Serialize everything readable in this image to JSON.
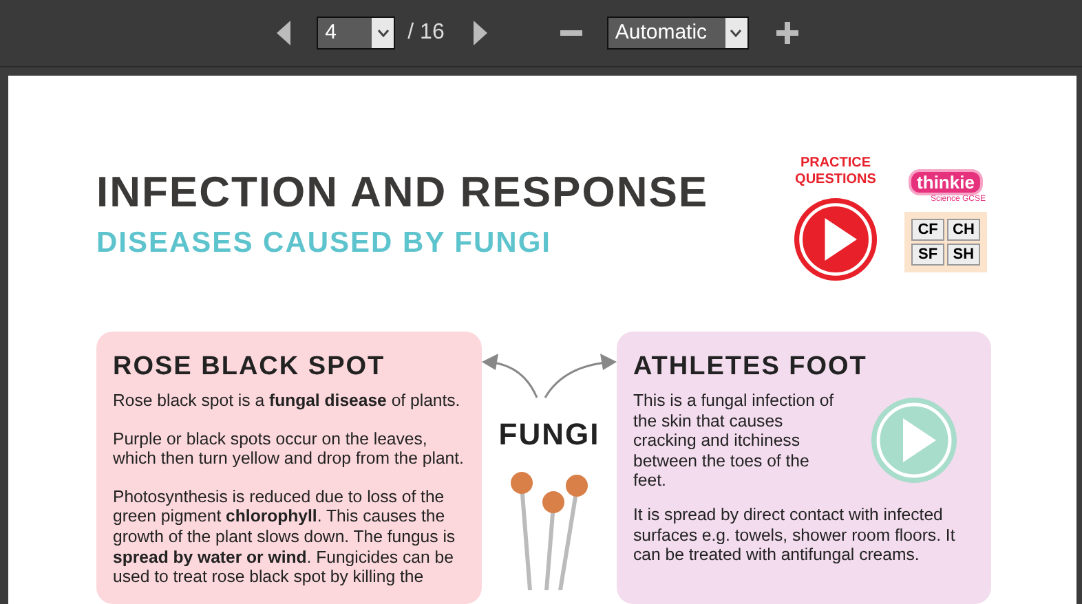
{
  "viewer": {
    "page_number": "4",
    "page_count": "/ 16",
    "zoom": "Automatic"
  },
  "header": {
    "title": "INFECTION AND RESPONSE",
    "subtitle": "DISEASES CAUSED BY FUNGI",
    "practice_label": "PRACTICE QUESTIONS",
    "logo": {
      "name": "thinkie",
      "tagline": "Science GCSE"
    },
    "tier_buttons": [
      "CF",
      "CH",
      "SF",
      "SH"
    ]
  },
  "center_label": "FUNGI",
  "cards": [
    {
      "title": "ROSE BLACK SPOT",
      "color": "#fcd8dc",
      "has_video": false,
      "paragraphs": [
        "Rose black spot is a **fungal disease** of plants.",
        "Purple or black spots occur on the leaves, which then turn yellow and drop from the plant.",
        "Photosynthesis is reduced due to loss of the green pigment **chlorophyll**. This causes the growth of the plant slows down. The fungus is **spread by water or wind**. Fungicides can be used to treat rose black spot by killing the"
      ]
    },
    {
      "title": "ATHLETES FOOT",
      "color": "#f3dcee",
      "has_video": true,
      "intro": [
        "This is a fungal infection of the skin that causes cracking and itchiness between the toes of the feet."
      ],
      "paragraphs": [
        "It is spread by direct contact with infected surfaces e.g. towels, shower room floors. It can be treated with antifungal creams."
      ]
    }
  ]
}
